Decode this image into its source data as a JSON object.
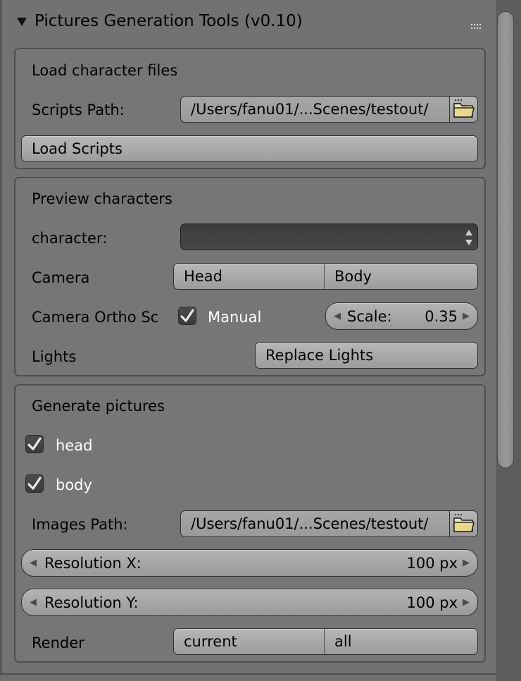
{
  "panel": {
    "title": "Pictures Generation Tools (v0.10)"
  },
  "load_section": {
    "heading": "Load character files",
    "scripts_path_label": "Scripts Path:",
    "scripts_path_value": "/Users/fanu01/...Scenes/testout/",
    "load_button": "Load Scripts"
  },
  "preview_section": {
    "heading": "Preview characters",
    "character_label": "character:",
    "character_value": "",
    "camera_label": "Camera",
    "camera_options": [
      "Head",
      "Body"
    ],
    "ortho_label": "Camera Ortho Sc",
    "manual_label": "Manual",
    "manual_checked": true,
    "scale_label": "Scale:",
    "scale_value": "0.35",
    "lights_label": "Lights",
    "replace_lights_button": "Replace Lights"
  },
  "generate_section": {
    "heading": "Generate pictures",
    "head_label": "head",
    "head_checked": true,
    "body_label": "body",
    "body_checked": true,
    "images_path_label": "Images Path:",
    "images_path_value": "/Users/fanu01/...Scenes/testout/",
    "res_x_label": "Resolution X:",
    "res_x_value": "100 px",
    "res_y_label": "Resolution Y:",
    "res_y_value": "100 px",
    "render_label": "Render",
    "render_options": [
      "current",
      "all"
    ]
  },
  "icons": {
    "collapse": "triangle-down-icon",
    "drag": "drag-handle-icon",
    "folder": "folder-icon",
    "updown": "updown-arrows-icon",
    "check": "checkmark-icon"
  }
}
